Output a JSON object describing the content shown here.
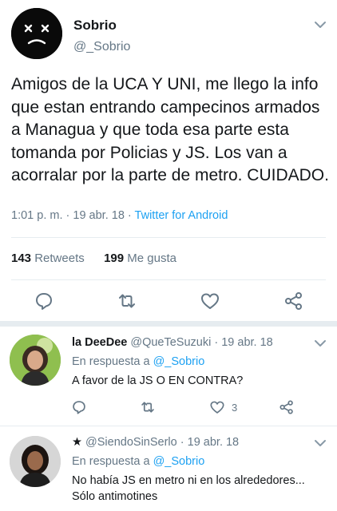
{
  "main_tweet": {
    "author_name": "Sobrio",
    "author_handle": "@_Sobrio",
    "text": "Amigos de la UCA Y UNI, me llego la info que estan entrando campecinos armados a Managua y que toda esa parte esta tomanda por Policias y JS. Los van a acorralar por la parte de metro. CUIDADO.",
    "time": "1:01 p. m.",
    "date": "19 abr. 18",
    "source": "Twitter for Android",
    "retweets_count": "143",
    "retweets_label": "Retweets",
    "likes_count": "199",
    "likes_label": "Me gusta"
  },
  "replies": [
    {
      "name": "la DeeDee",
      "handle": "@QueTeSuzuki",
      "date": "19 abr. 18",
      "reply_prefix": "En respuesta a",
      "reply_mention": "@_Sobrio",
      "text": "A favor de la JS O EN CONTRA?",
      "like_count": "3"
    },
    {
      "name": "★",
      "handle": "@SiendoSinSerlo",
      "date": "19 abr. 18",
      "reply_prefix": "En respuesta a",
      "reply_mention": "@_Sobrio",
      "text_line1": "No había JS en metro ni en los alrededores...",
      "text_line2": "Sólo antimotines"
    }
  ],
  "separator": "·",
  "colors": {
    "text": "#14171a",
    "secondary": "#657786",
    "link": "#1da1f2",
    "divider": "#e6ecf0"
  },
  "icons": [
    "sad-face-avatar",
    "chevron-down-icon",
    "reply-icon",
    "retweet-icon",
    "heart-icon",
    "share-icon"
  ]
}
